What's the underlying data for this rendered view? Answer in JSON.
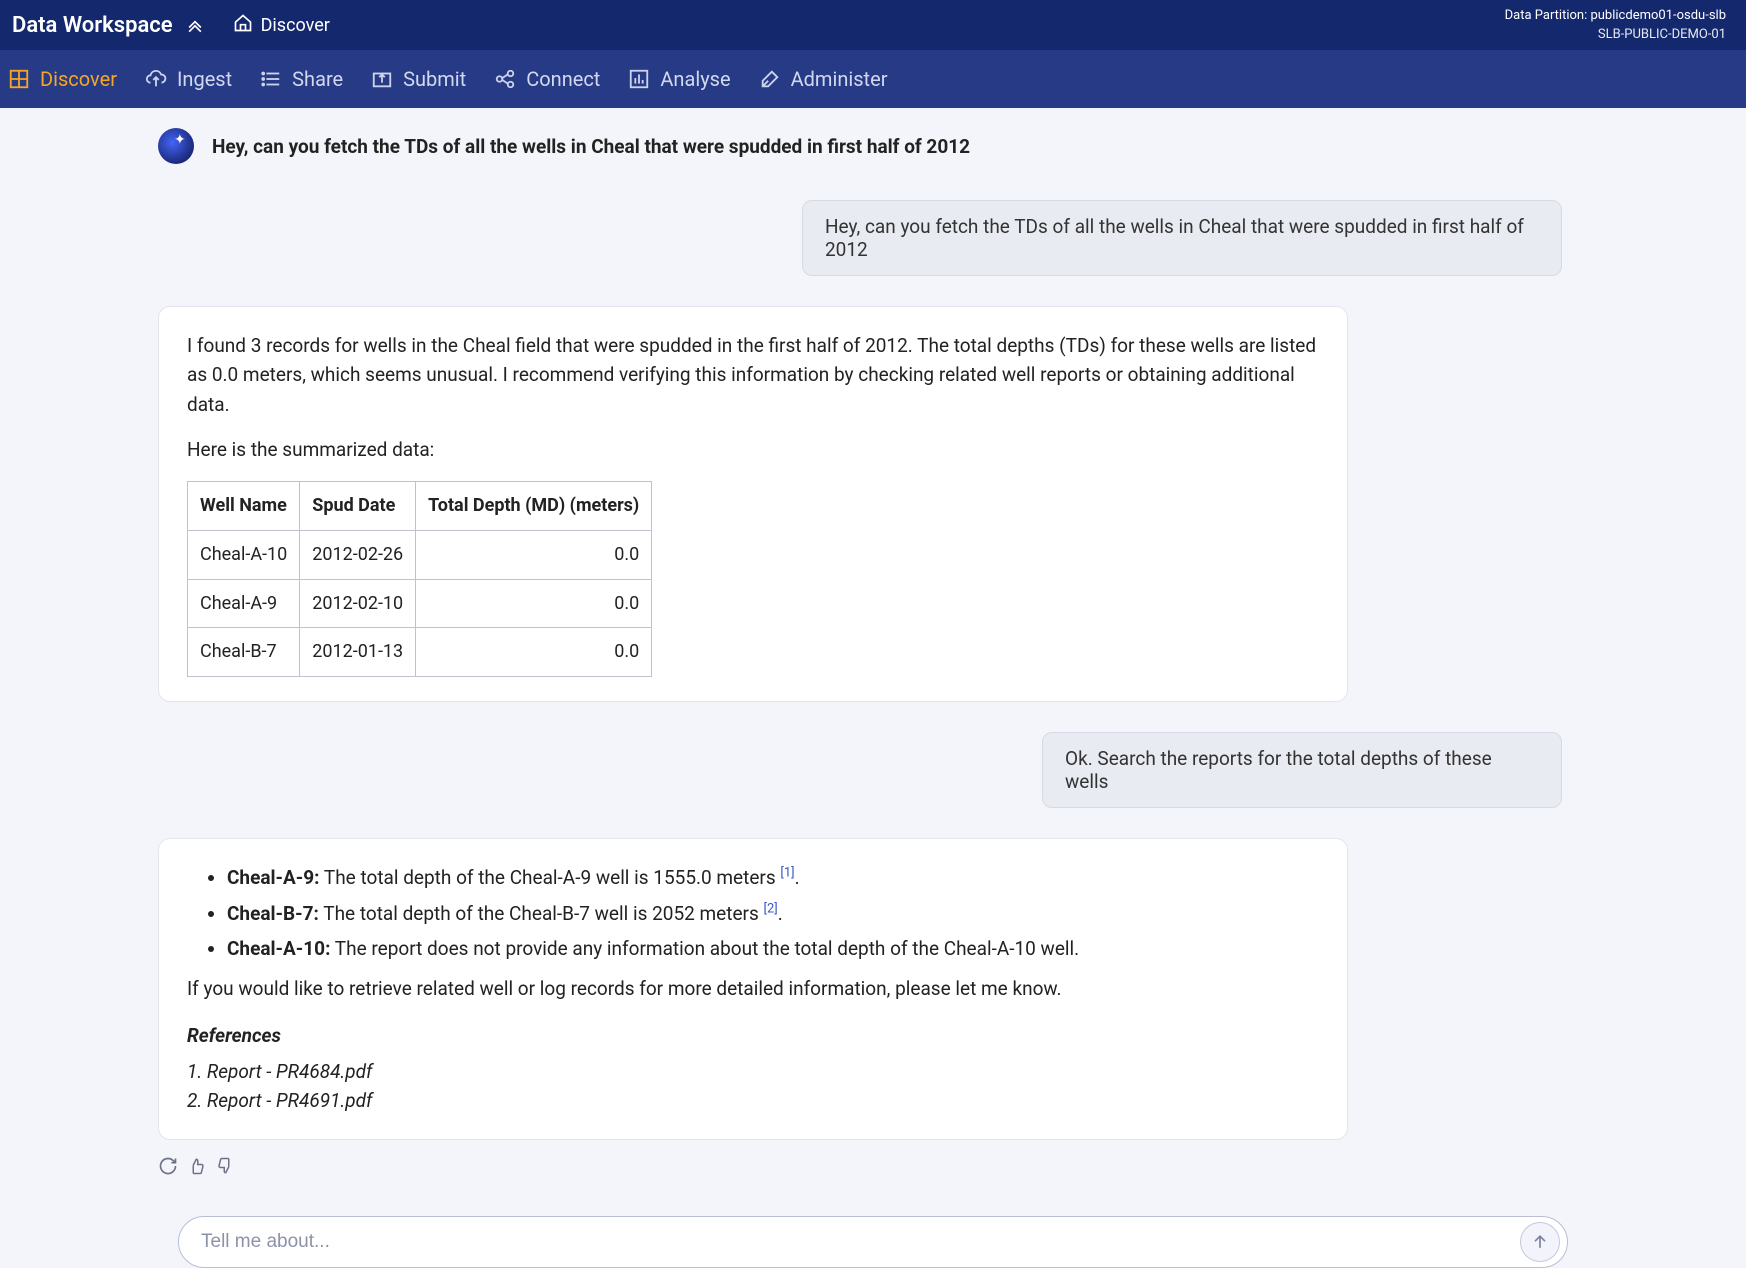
{
  "header": {
    "brand": "Data Workspace",
    "home_label": "Discover",
    "partition_line1": "Data Partition: publicdemo01-osdu-slb",
    "partition_line2": "SLB-PUBLIC-DEMO-01"
  },
  "nav": {
    "items": [
      {
        "label": "Discover",
        "active": true
      },
      {
        "label": "Ingest"
      },
      {
        "label": "Share"
      },
      {
        "label": "Submit"
      },
      {
        "label": "Connect"
      },
      {
        "label": "Analyse"
      },
      {
        "label": "Administer"
      }
    ]
  },
  "conversation": {
    "title_prompt": "Hey, can you fetch the TDs of all the wells in Cheal that were spudded in first half of 2012",
    "user_msg_1": "Hey, can you fetch the TDs of all the wells in Cheal that were spudded in first half of 2012",
    "assistant_1": {
      "para1": "I found 3 records for wells in the Cheal field that were spudded in the first half of 2012. The total depths (TDs) for these wells are listed as 0.0 meters, which seems unusual. I recommend verifying this information by checking related well reports or obtaining additional data.",
      "para2": "Here is the summarized data:",
      "table": {
        "headers": [
          "Well Name",
          "Spud Date",
          "Total Depth (MD) (meters)"
        ],
        "rows": [
          {
            "well": "Cheal-A-10",
            "spud": "2012-02-26",
            "td": "0.0"
          },
          {
            "well": "Cheal-A-9",
            "spud": "2012-02-10",
            "td": "0.0"
          },
          {
            "well": "Cheal-B-7",
            "spud": "2012-01-13",
            "td": "0.0"
          }
        ]
      }
    },
    "user_msg_2": "Ok. Search the reports for the total depths of these wells",
    "assistant_2": {
      "items": [
        {
          "label": "Cheal-A-9:",
          "text": " The total depth of the Cheal-A-9 well is 1555.0 meters ",
          "cite": "[1]"
        },
        {
          "label": "Cheal-B-7:",
          "text": " The total depth of the Cheal-B-7 well is 2052 meters ",
          "cite": "[2]"
        },
        {
          "label": "Cheal-A-10:",
          "text": " The report does not provide any information about the total depth of the Cheal-A-10 well.",
          "cite": ""
        }
      ],
      "closing": "If you would like to retrieve related well or log records for more detailed information, please let me know.",
      "references_heading": "References",
      "references": [
        "1. Report - PR4684.pdf",
        "2. Report - PR4691.pdf"
      ]
    }
  },
  "input": {
    "placeholder": "Tell me about..."
  }
}
